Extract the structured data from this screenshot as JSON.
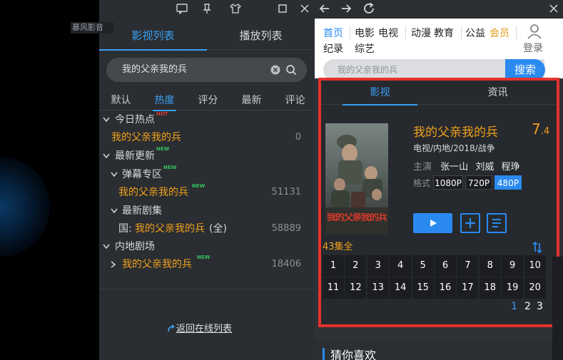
{
  "video_area": {
    "watermark": "暴风影音"
  },
  "left_panel": {
    "tabs": [
      "影视列表",
      "播放列表"
    ],
    "search_value": "我的父亲我的兵",
    "sort_tabs": [
      "默认",
      "热度",
      "评分",
      "最新",
      "评论"
    ],
    "active_sort": "热度",
    "tree": {
      "today_hot": {
        "label": "今日热点",
        "item": "我的父亲我的兵",
        "count": "0",
        "badge": "HOT"
      },
      "latest": {
        "label": "最新更新",
        "badge": "NEW"
      },
      "danmu": {
        "label": "弹幕专区",
        "badge": "NEW",
        "item": "我的父亲我的兵",
        "item_badge": "NEW",
        "count": "51131"
      },
      "newest_drama": {
        "label": "最新剧集",
        "prefix": "国:",
        "item": "我的父亲我的兵",
        "suffix": "(全)",
        "count": "58889"
      },
      "mainland": {
        "label": "内地剧场",
        "item": "我的父亲我的兵",
        "item_badge": "NEW",
        "count": "18406"
      }
    },
    "back_link": "返回在线列表"
  },
  "browser": {
    "nav": {
      "home": "首页",
      "movie": "电影",
      "tv": "电视",
      "anime": "动漫",
      "edu": "教育",
      "charity": "公益",
      "vip": "会员",
      "doc": "纪录",
      "variety": "综艺",
      "login": "登录"
    },
    "search_placeholder": "我的父亲我的兵",
    "search_button": "搜索",
    "result_tabs": [
      "影视",
      "资讯"
    ],
    "movie": {
      "title": "我的父亲我的兵",
      "score_int": "7",
      "score_dec": ".4",
      "info": "电视/内地/2018/战争",
      "cast_label": "主演",
      "cast": [
        "张一山",
        "刘威",
        "程琤"
      ],
      "format_label": "格式",
      "formats": [
        "1080P",
        "720P",
        "480P"
      ],
      "selected_format": "480P",
      "poster_text": "我的父亲我的兵",
      "episode_total": "43集全",
      "episodes": [
        "1",
        "2",
        "3",
        "4",
        "5",
        "6",
        "7",
        "8",
        "9",
        "10",
        "11",
        "12",
        "13",
        "14",
        "15",
        "16",
        "17",
        "18",
        "19",
        "20"
      ],
      "pages": [
        "1",
        "2",
        "3"
      ],
      "current_page": "1"
    },
    "guess_like": "猜你喜欢"
  }
}
